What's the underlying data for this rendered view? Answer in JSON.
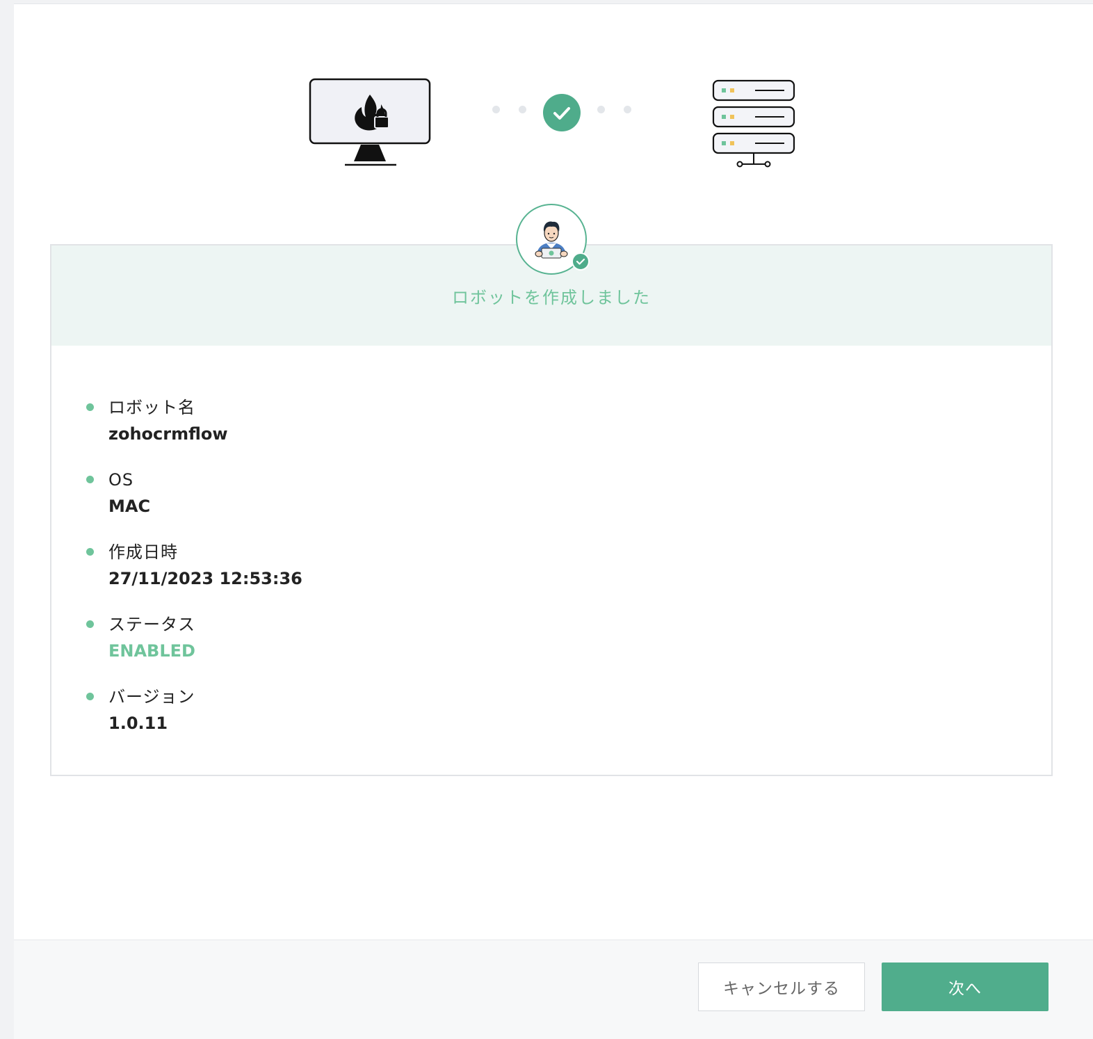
{
  "colors": {
    "accent": "#4fac8b",
    "accent_light": "#6fc49b",
    "banner_bg": "#edf5f3"
  },
  "icons": {
    "source": "monitor-firewall-icon",
    "status": "check-icon",
    "target": "server-icon",
    "avatar": "robot-user-avatar-icon"
  },
  "result": {
    "title": "ロボットを作成しました"
  },
  "details": [
    {
      "label": "ロボット名",
      "value": "zohocrmflow"
    },
    {
      "label": "OS",
      "value": "MAC"
    },
    {
      "label": "作成日時",
      "value": "27/11/2023 12:53:36"
    },
    {
      "label": "ステータス",
      "value": "ENABLED"
    },
    {
      "label": "バージョン",
      "value": "1.0.11"
    }
  ],
  "footer": {
    "cancel_label": "キャンセルする",
    "next_label": "次へ"
  }
}
